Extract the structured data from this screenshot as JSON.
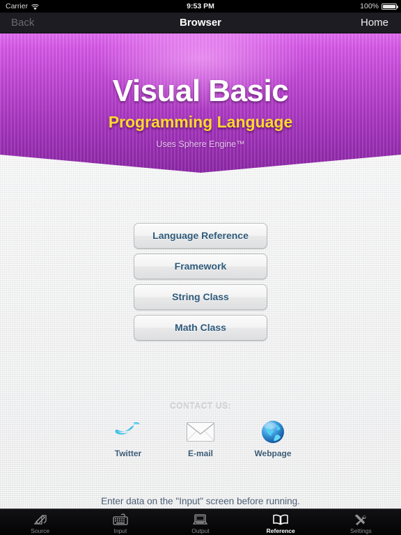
{
  "status_bar": {
    "carrier": "Carrier",
    "wifi_icon": "wifi-icon",
    "time": "9:53 PM",
    "battery_percent": "100%",
    "battery_icon": "battery-full-icon"
  },
  "nav_bar": {
    "back_label": "Back",
    "title": "Browser",
    "home_label": "Home"
  },
  "banner": {
    "title": "Visual Basic",
    "subtitle": "Programming Language",
    "engine": "Uses Sphere Engine™",
    "gradient_top": "#e06cf0",
    "gradient_bottom": "#8c28a6",
    "title_color": "#ffffff",
    "subtitle_color": "#ffd92e",
    "engine_color": "#e7c6ef"
  },
  "menu": {
    "buttons": [
      {
        "label": "Language Reference",
        "name": "language-reference-button"
      },
      {
        "label": "Framework",
        "name": "framework-button"
      },
      {
        "label": "String Class",
        "name": "string-class-button"
      },
      {
        "label": "Math Class",
        "name": "math-class-button"
      }
    ],
    "text_color": "#2e5a7a"
  },
  "contact": {
    "heading": "CONTACT US:",
    "items": [
      {
        "label": "Twitter",
        "icon": "twitter-bird-icon"
      },
      {
        "label": "E-mail",
        "icon": "envelope-icon"
      },
      {
        "label": "Webpage",
        "icon": "globe-icon"
      }
    ]
  },
  "footer_note": "Enter data on the \"Input\" screen before running.",
  "tab_bar": {
    "tabs": [
      {
        "label": "Source",
        "icon": "pencil-paper-icon",
        "active": false
      },
      {
        "label": "Input",
        "icon": "keyboard-icon",
        "active": false
      },
      {
        "label": "Output",
        "icon": "laptop-icon",
        "active": false
      },
      {
        "label": "Reference",
        "icon": "open-book-icon",
        "active": true
      },
      {
        "label": "Settings",
        "icon": "tools-icon",
        "active": false
      }
    ],
    "active_color": "#ffffff",
    "inactive_color": "#8d8d90"
  }
}
